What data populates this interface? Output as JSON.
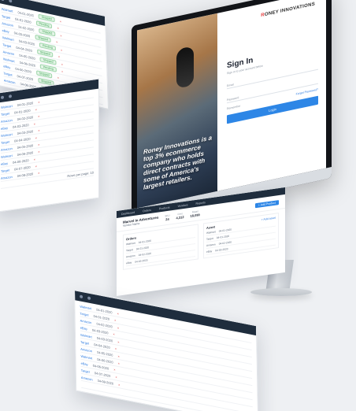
{
  "brand": {
    "logo_mark": "R",
    "logo_text": "ONEY INNOVATIONS"
  },
  "tagline": "Roney Innovations is a top 3% ecommerce company who holds direct contracts with some of America's largest retailers.",
  "signin": {
    "title": "Sign In",
    "subtitle": "Sign in to your account below",
    "email_label": "Email",
    "password_label": "Password",
    "remember_label": "Remember",
    "forgot_label": "Forgot Password?",
    "button_label": "Login"
  },
  "dashboard": {
    "title": "Marvel In Adventures",
    "merchant": "Vendor Name",
    "add_label": "+ Add Product",
    "panel_left_title": "Orders",
    "panel_right_title": "Asset",
    "panel_right_link": "+ Add asset",
    "stats": [
      {
        "label": "SKU",
        "value": "24"
      },
      {
        "label": "Cost",
        "value": "4,312"
      },
      {
        "label": "Retail",
        "value": "18,090"
      }
    ],
    "nav": [
      "Dashboard",
      "Orders",
      "Products",
      "Vendors",
      "Reports"
    ]
  },
  "sheet_rows": [
    {
      "col1": "Walmart",
      "col2": "04-01-2020",
      "status": "Shipped"
    },
    {
      "col1": "Target",
      "col2": "04-01-2020",
      "status": "Pending"
    },
    {
      "col1": "Amazon",
      "col2": "04-02-2020",
      "status": "Shipped"
    },
    {
      "col1": "eBay",
      "col2": "04-03-2020",
      "status": "Shipped"
    },
    {
      "col1": "Walmart",
      "col2": "04-03-2020",
      "status": "Pending"
    },
    {
      "col1": "Target",
      "col2": "04-04-2020",
      "status": "Shipped"
    },
    {
      "col1": "Amazon",
      "col2": "04-05-2020",
      "status": "Shipped"
    },
    {
      "col1": "Walmart",
      "col2": "04-06-2020",
      "status": "Pending"
    },
    {
      "col1": "eBay",
      "col2": "04-06-2020",
      "status": "Shipped"
    },
    {
      "col1": "Target",
      "col2": "04-07-2020",
      "status": "Shipped"
    },
    {
      "col1": "Amazon",
      "col2": "04-08-2020",
      "status": "Pending"
    }
  ],
  "pager": "Rows per page: 10",
  "colors": {
    "accent": "#2d86e6",
    "navy": "#1f2d3d",
    "brand_red": "#e63c3c"
  }
}
